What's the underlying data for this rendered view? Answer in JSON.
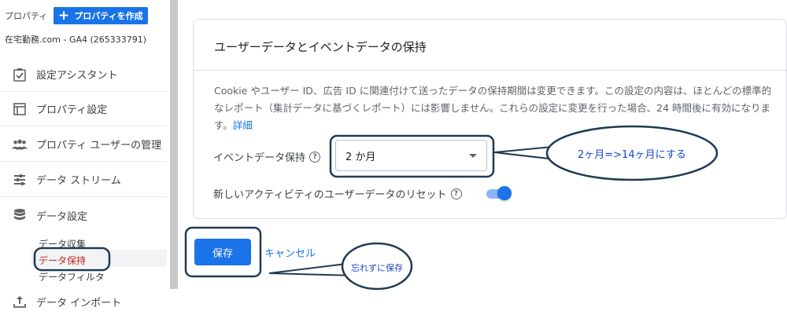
{
  "sidebar": {
    "property_label": "プロパティ",
    "create_property": "プロパティを作成",
    "account_line": "在宅勤務.com - GA4 (265333791)",
    "nav": [
      {
        "label": "設定アシスタント",
        "icon": "checklist-icon"
      },
      {
        "label": "プロパティ設定",
        "icon": "layout-icon"
      },
      {
        "label": "プロパティ ユーザーの管理",
        "icon": "people-icon"
      },
      {
        "label": "データ ストリーム",
        "icon": "streams-icon"
      },
      {
        "label": "データ設定",
        "icon": "database-icon"
      }
    ],
    "sub_items": [
      "データ収集",
      "データ保持",
      "データフィルタ"
    ],
    "import": {
      "label": "データ インポート",
      "icon": "upload-icon"
    }
  },
  "card": {
    "title": "ユーザーデータとイベントデータの保持",
    "description": "Cookie やユーザー ID、広告 ID に関連付けて送ったデータの保持期間は変更できます。この設定の内容は、ほとんどの標準的なレポート（集計データに基づくレポート）には影響しません。これらの設定に変更を行った場合、24 時間後に有効になります。",
    "details_link": "詳細",
    "event_retention_label": "イベントデータ保持",
    "event_retention_value": "2 か月",
    "reset_label": "新しいアクティビティのユーザーデータのリセット",
    "reset_enabled": true
  },
  "actions": {
    "save": "保存",
    "cancel": "キャンセル"
  },
  "annotations": {
    "callout_1": "2ヶ月=>14ヶ月にする",
    "callout_2": "忘れずに保存",
    "color": "#1f3b53"
  },
  "colors": {
    "accent": "#1a73e8",
    "active_sub": "#c5221f"
  }
}
